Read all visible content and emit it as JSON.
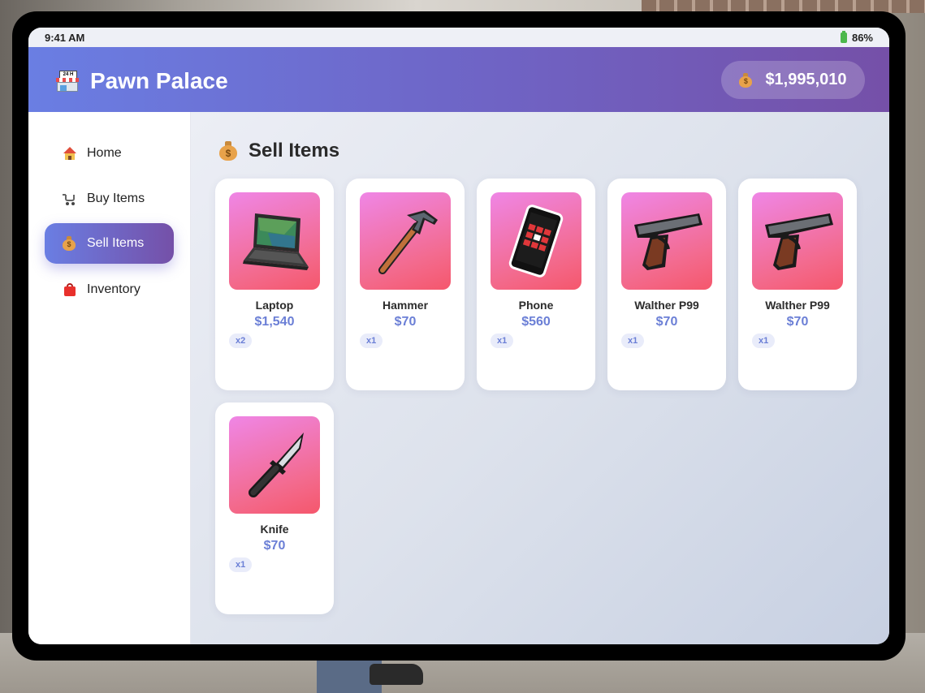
{
  "status": {
    "time": "9:41 AM",
    "battery": "86%"
  },
  "header": {
    "title": "Pawn Palace",
    "balance": "$1,995,010",
    "store_sign": "24 H"
  },
  "sidebar": {
    "items": [
      {
        "label": "Home",
        "icon": "house-icon",
        "active": false
      },
      {
        "label": "Buy Items",
        "icon": "cart-icon",
        "active": false
      },
      {
        "label": "Sell Items",
        "icon": "money-bag-icon",
        "active": true
      },
      {
        "label": "Inventory",
        "icon": "shopping-bag-icon",
        "active": false
      }
    ]
  },
  "main": {
    "title": "Sell Items",
    "items": [
      {
        "name": "Laptop",
        "price": "$1,540",
        "qty": "x2",
        "icon": "laptop-icon"
      },
      {
        "name": "Hammer",
        "price": "$70",
        "qty": "x1",
        "icon": "hammer-icon"
      },
      {
        "name": "Phone",
        "price": "$560",
        "qty": "x1",
        "icon": "phone-icon"
      },
      {
        "name": "Walther P99",
        "price": "$70",
        "qty": "x1",
        "icon": "pistol-icon"
      },
      {
        "name": "Walther P99",
        "price": "$70",
        "qty": "x1",
        "icon": "pistol-icon"
      },
      {
        "name": "Knife",
        "price": "$70",
        "qty": "x1",
        "icon": "knife-icon"
      }
    ]
  },
  "colors": {
    "accent_start": "#6a7ee3",
    "accent_end": "#7550a8",
    "price": "#6b7fd6",
    "thumb_start": "#ef86e6",
    "thumb_end": "#f5576c"
  }
}
